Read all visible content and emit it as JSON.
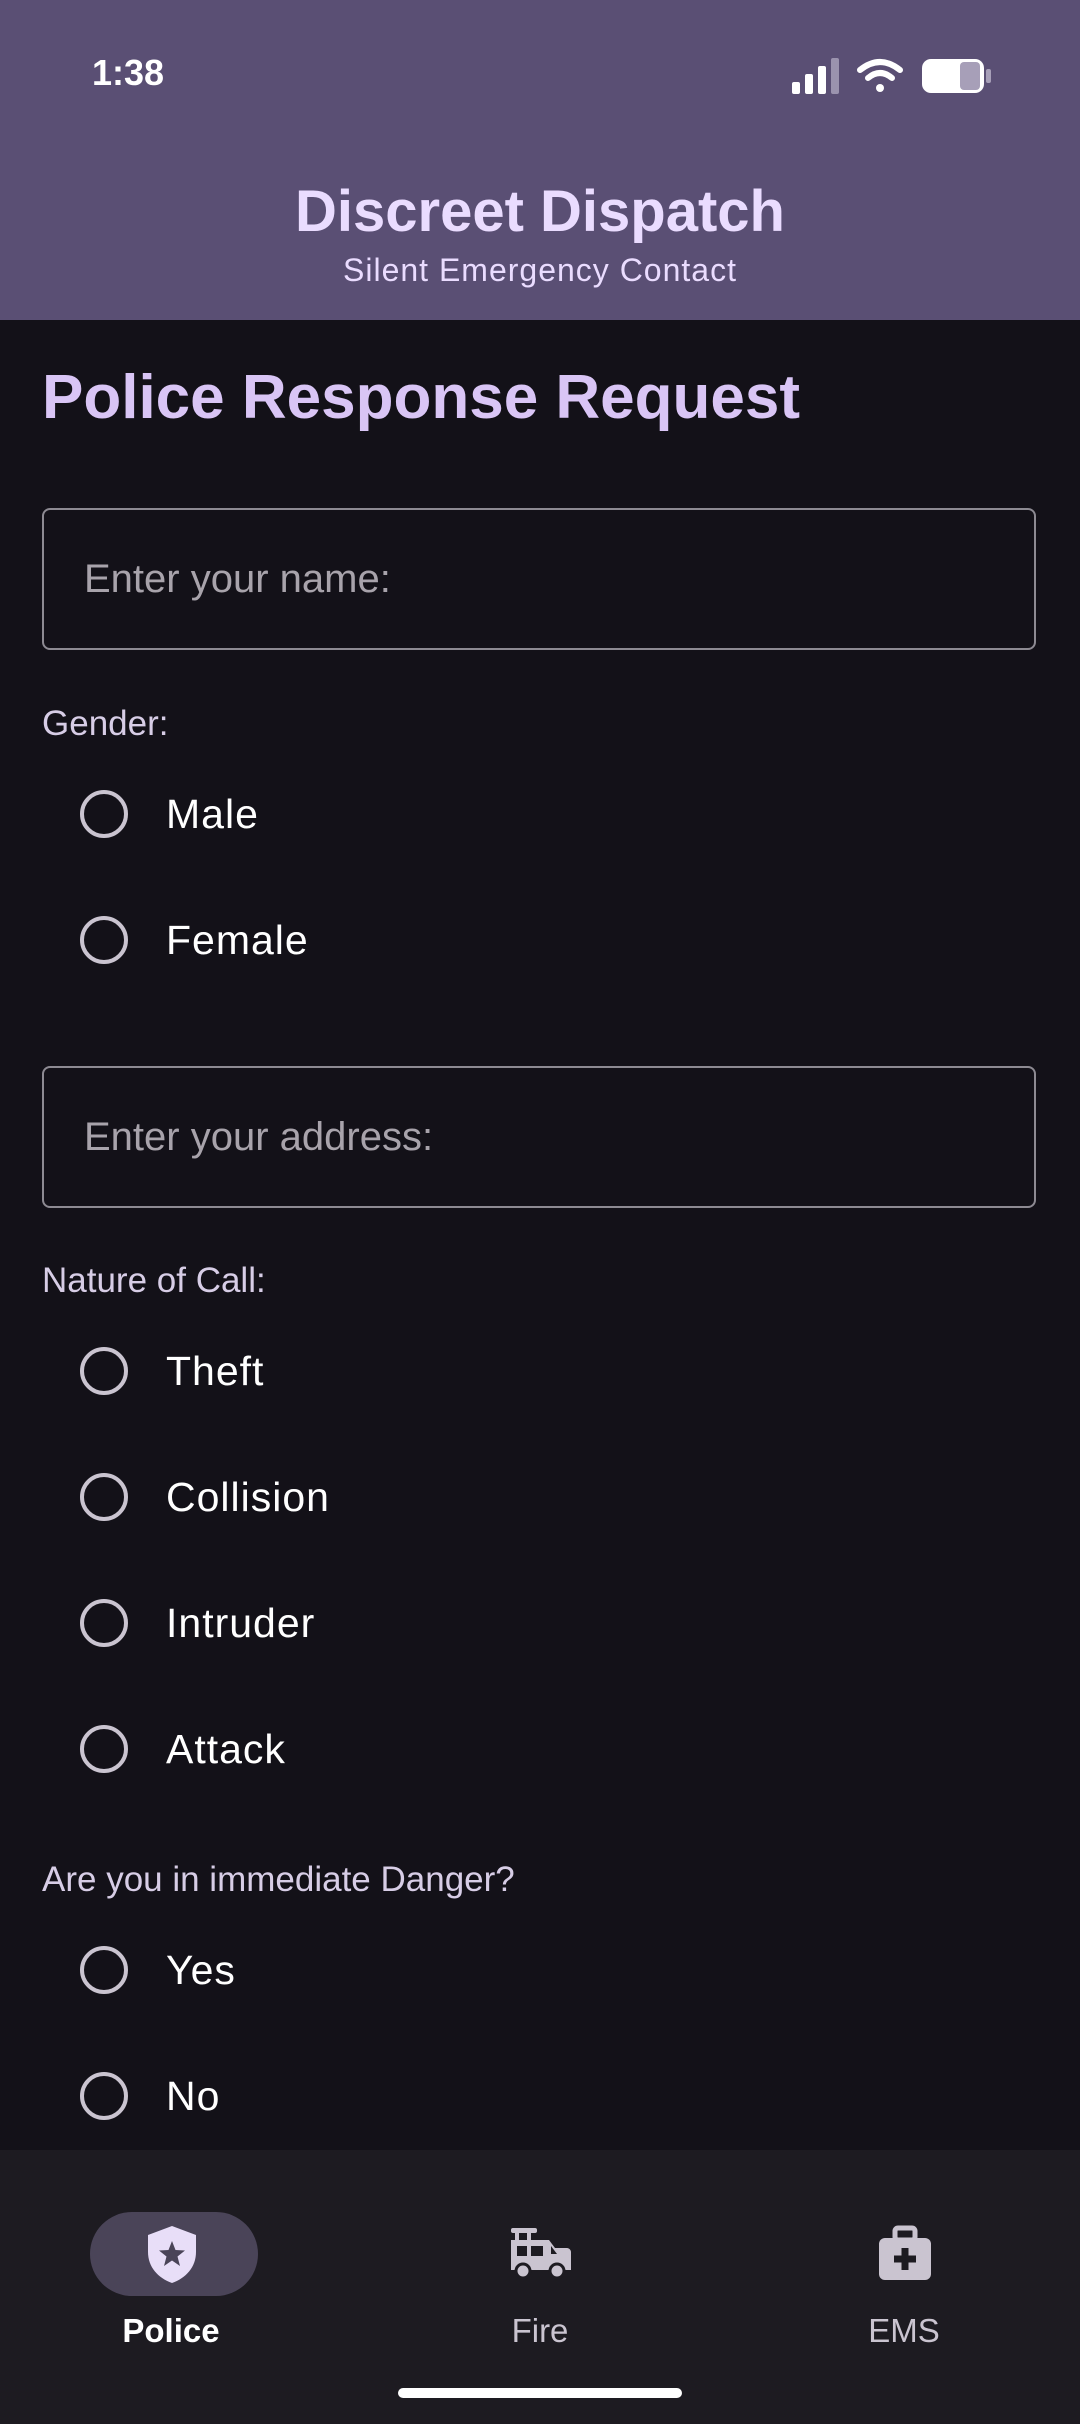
{
  "status_bar": {
    "time": "1:38"
  },
  "header": {
    "title": "Discreet Dispatch",
    "subtitle": "Silent Emergency Contact"
  },
  "form": {
    "title": "Police Response Request",
    "name_field": {
      "placeholder": "Enter your name:",
      "value": ""
    },
    "gender": {
      "label": "Gender:",
      "options": [
        "Male",
        "Female"
      ]
    },
    "address_field": {
      "placeholder": "Enter your address:",
      "value": ""
    },
    "nature": {
      "label": "Nature of Call:",
      "options": [
        "Theft",
        "Collision",
        "Intruder",
        "Attack"
      ]
    },
    "danger": {
      "label": "Are you in immediate Danger?",
      "options": [
        "Yes",
        "No"
      ]
    }
  },
  "bottom_nav": {
    "active": "Police",
    "items": [
      {
        "label": "Police",
        "icon": "police-shield-icon"
      },
      {
        "label": "Fire",
        "icon": "fire-truck-icon"
      },
      {
        "label": "EMS",
        "icon": "medical-kit-icon"
      }
    ]
  },
  "colors": {
    "header_bg": "#5a4f74",
    "page_bg": "#131118",
    "title_accent": "#d9c5f5",
    "nav_bg": "#1d1b21",
    "active_pill": "#4a4458"
  }
}
